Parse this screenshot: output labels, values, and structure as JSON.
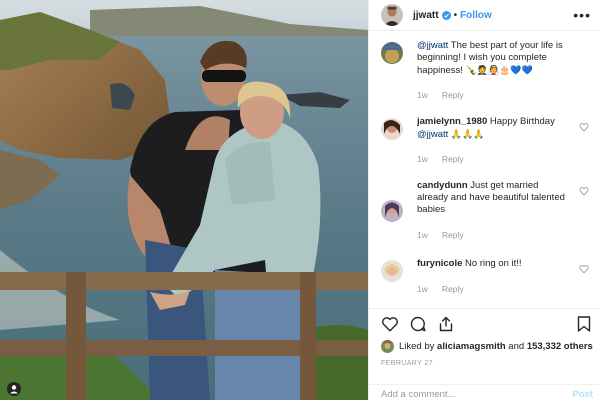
{
  "header": {
    "username": "jjwatt",
    "separator": "•",
    "follow_label": "Follow",
    "more_glyph": "•••"
  },
  "comments": [
    {
      "mention": "@jjwatt",
      "text": " The best part of your life is beginning! I wish you complete happiness!",
      "emoji": "🍾🤵👰🎂💙💙",
      "time": "1w",
      "reply": "Reply"
    },
    {
      "user": "jamielynn_1980",
      "text": " Happy Birthday ",
      "mention": "@jjwatt",
      "emoji": " 🙏🙏🙏",
      "time": "1w",
      "reply": "Reply"
    },
    {
      "user": "candydunn",
      "text": " Just get married already and have beautiful talented babies",
      "time": "1w",
      "reply": "Reply"
    },
    {
      "user": "furynicole",
      "text": " No ring on it!!",
      "time": "1w",
      "reply": "Reply"
    }
  ],
  "likes": {
    "prefix": "Liked by ",
    "user": "aliciamagsmith",
    "middle": " and ",
    "count": "153,332 others"
  },
  "date": "FEBRUARY 27",
  "add_comment": {
    "placeholder": "Add a comment...",
    "post_label": "Post"
  },
  "colors": {
    "link": "#3897f0",
    "text": "#262626",
    "muted": "#999999",
    "post_disabled": "#b2dffc"
  }
}
